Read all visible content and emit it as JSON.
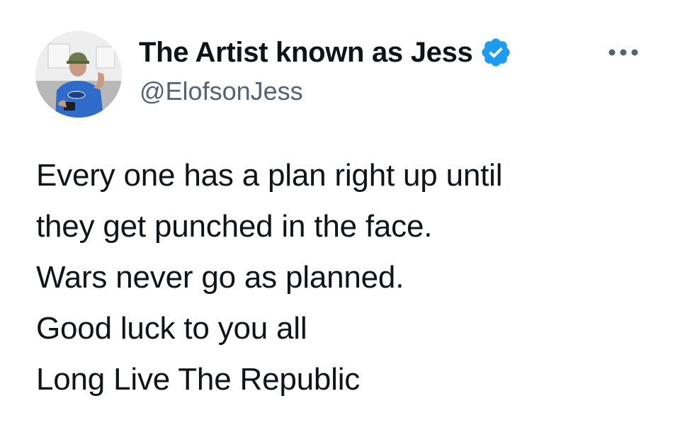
{
  "author": {
    "display_name": "The Artist known as Jess",
    "handle": "@ElofsonJess",
    "verified": true,
    "avatar_icon": "profile-photo",
    "verified_icon": "verified-badge-icon"
  },
  "actions": {
    "more_icon": "more-options-icon"
  },
  "tweet": {
    "lines": [
      "Every one has a plan right up until",
      "they get punched in the face.",
      "Wars never go as planned.",
      "Good luck to you all",
      "Long Live The Republic"
    ]
  },
  "colors": {
    "text_primary": "#0f1419",
    "text_secondary": "#536471",
    "verified_blue": "#1d9bf0",
    "background": "#ffffff"
  }
}
